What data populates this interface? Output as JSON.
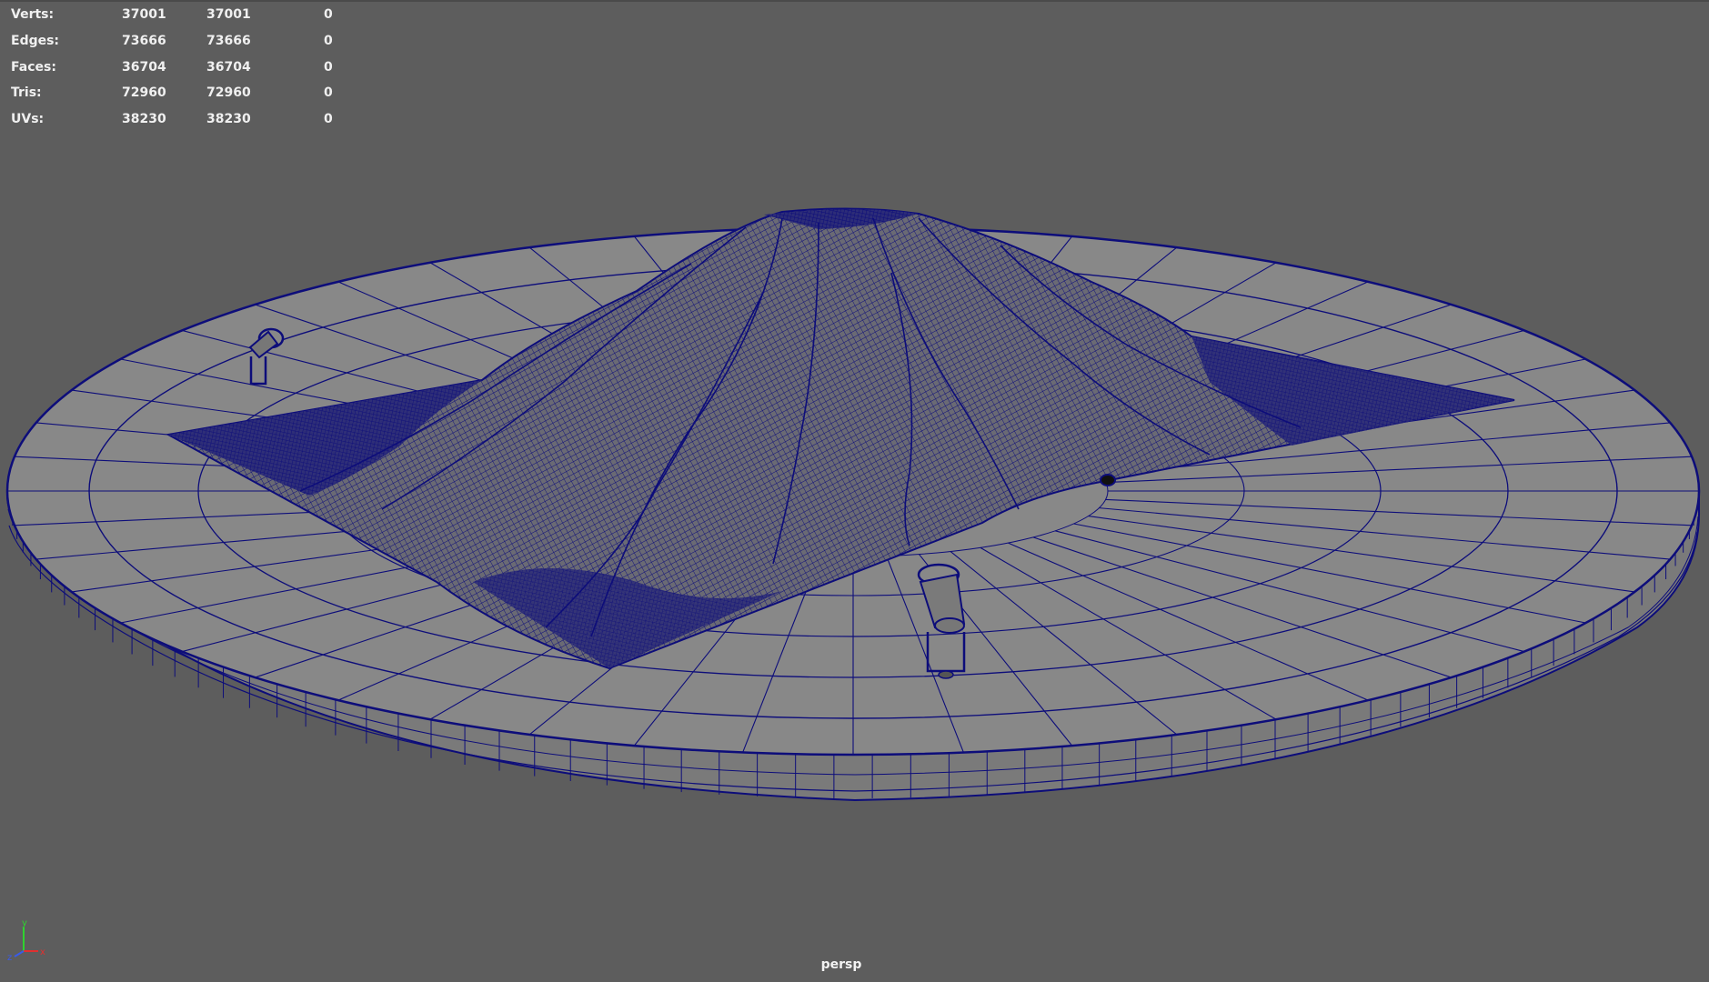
{
  "viewport": {
    "background": "#5d5d5d",
    "wire_color": "#0d0d7a",
    "camera": "persp"
  },
  "hud": {
    "rows": [
      {
        "label": "Verts:",
        "v1": "37001",
        "v2": "37001",
        "v3": "0"
      },
      {
        "label": "Edges:",
        "v1": "73666",
        "v2": "73666",
        "v3": "0"
      },
      {
        "label": "Faces:",
        "v1": "36704",
        "v2": "36704",
        "v3": "0"
      },
      {
        "label": "Tris:",
        "v1": "72960",
        "v2": "72960",
        "v3": "0"
      },
      {
        "label": "UVs:",
        "v1": "38230",
        "v2": "38230",
        "v3": "0"
      }
    ]
  },
  "axis_gizmo": {
    "y": "y",
    "z": "z",
    "x": "x",
    "y_color": "#2fd22f",
    "x_color": "#e03030",
    "z_color": "#3a5be8"
  }
}
